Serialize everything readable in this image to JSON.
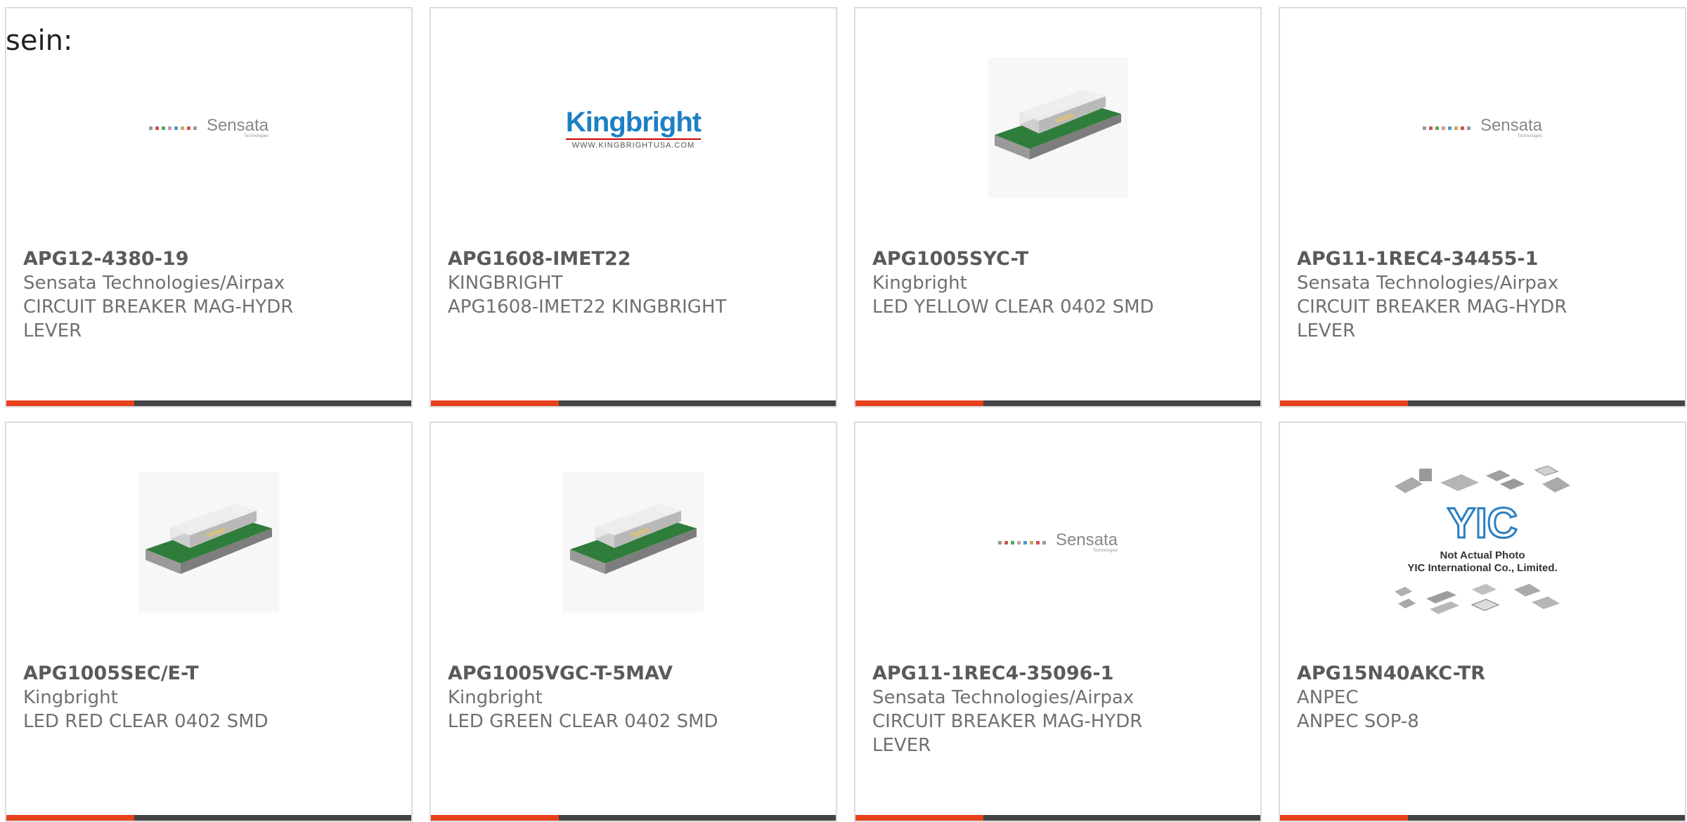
{
  "stray_text": "sein:",
  "colors": {
    "accent": "#e8401c",
    "bar_dark": "#444444",
    "card_border": "#dcdcdc",
    "text": "#707070"
  },
  "products": [
    {
      "part_number": "APG12-4380-19",
      "manufacturer": "Sensata Technologies/Airpax",
      "description": "CIRCUIT BREAKER MAG-HYDR LEVER",
      "image": "sensata-logo"
    },
    {
      "part_number": "APG1608-IMET22",
      "manufacturer": "KINGBRIGHT",
      "description": "APG1608-IMET22 KINGBRIGHT",
      "image": "kingbright-logo",
      "logo_text": "Kingbright",
      "logo_url": "WWW.KINGBRIGHTUSA.COM"
    },
    {
      "part_number": "APG1005SYC-T",
      "manufacturer": "Kingbright",
      "description": "LED YELLOW CLEAR 0402 SMD",
      "image": "smd-led-photo"
    },
    {
      "part_number": "APG11-1REC4-34455-1",
      "manufacturer": "Sensata Technologies/Airpax",
      "description": "CIRCUIT BREAKER MAG-HYDR LEVER",
      "image": "sensata-logo"
    },
    {
      "part_number": "APG1005SEC/E-T",
      "manufacturer": "Kingbright",
      "description": "LED RED CLEAR 0402 SMD",
      "image": "smd-led-photo"
    },
    {
      "part_number": "APG1005VGC-T-5MAV",
      "manufacturer": "Kingbright",
      "description": "LED GREEN CLEAR 0402 SMD",
      "image": "smd-led-photo"
    },
    {
      "part_number": "APG11-1REC4-35096-1",
      "manufacturer": "Sensata Technologies/Airpax",
      "description": "CIRCUIT BREAKER MAG-HYDR LEVER",
      "image": "sensata-logo"
    },
    {
      "part_number": "APG15N40AKC-TR",
      "manufacturer": "ANPEC",
      "description": "ANPEC SOP-8",
      "image": "yic-placeholder",
      "placeholder_line1": "Not Actual Photo",
      "placeholder_line2": "YIC International Co., Limited."
    }
  ],
  "sensata_logo": {
    "word": "Sensata",
    "sub": "Technologies"
  }
}
